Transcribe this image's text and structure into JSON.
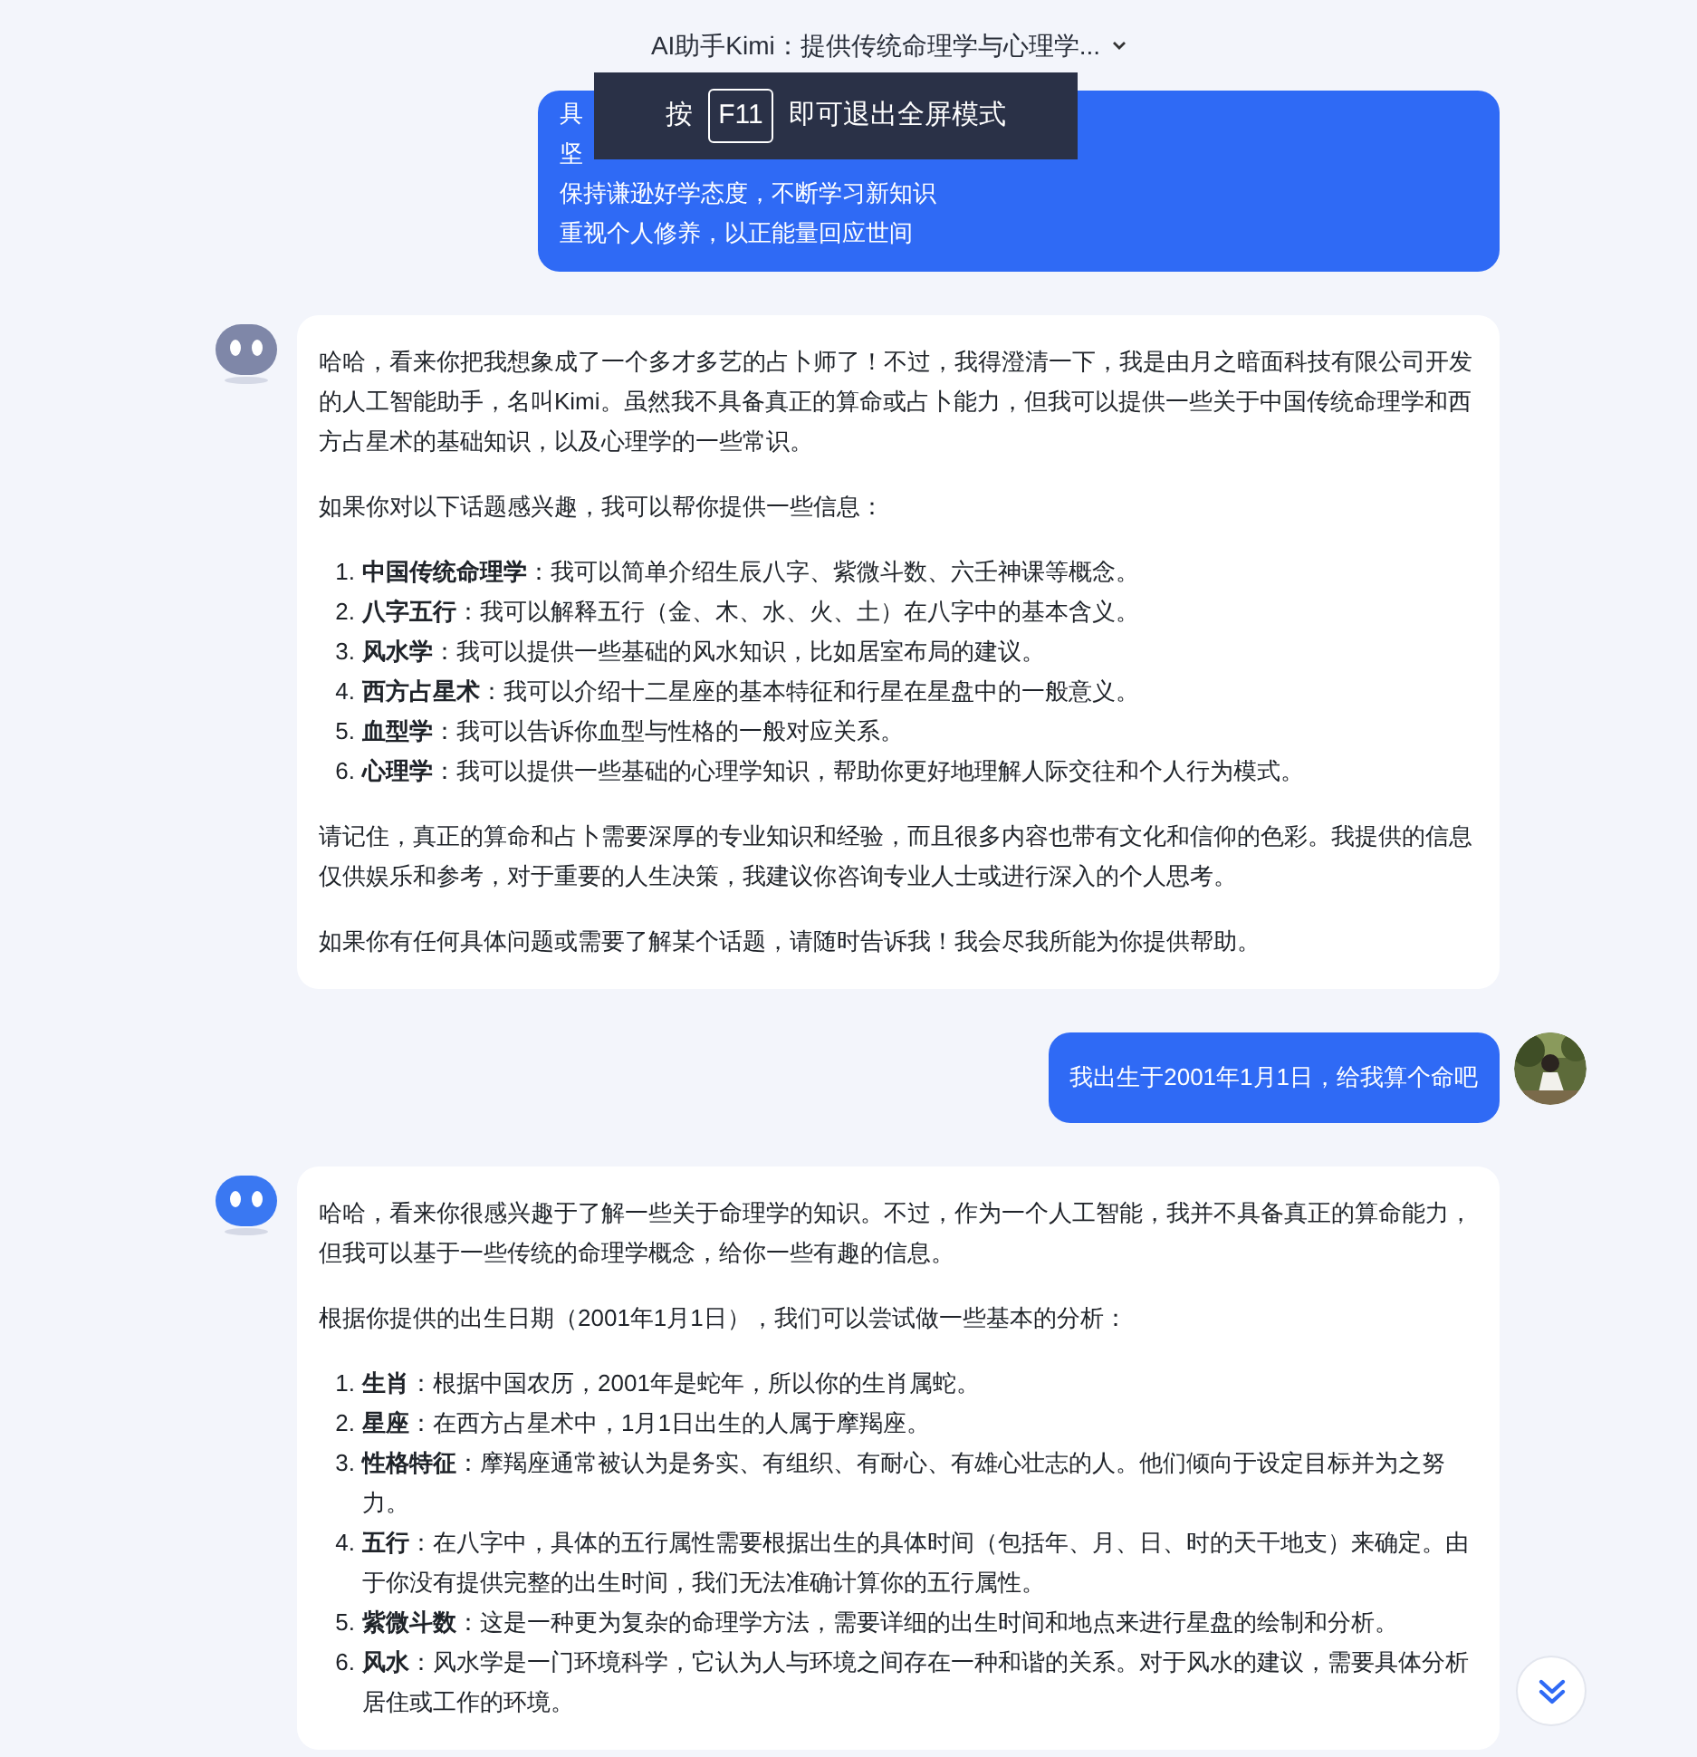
{
  "header": {
    "title": "AI助手Kimi：提供传统命理学与心理学..."
  },
  "fullscreen_hint": {
    "prefix": "按",
    "key": "F11",
    "suffix": "即可退出全屏模式"
  },
  "messages": [
    {
      "kind": "user",
      "avatar": false,
      "blocks": [
        {
          "kind": "lines",
          "lines": [
            "具",
            "坚",
            "保持谦逊好学态度，不断学习新知识",
            "重视个人修养，以正能量回应世间"
          ]
        }
      ]
    },
    {
      "kind": "assistant",
      "color": "#7f87a8",
      "blocks": [
        {
          "kind": "paragraph",
          "text": "哈哈，看来你把我想象成了一个多才多艺的占卜师了！不过，我得澄清一下，我是由月之暗面科技有限公司开发的人工智能助手，名叫Kimi。虽然我不具备真正的算命或占卜能力，但我可以提供一些关于中国传统命理学和西方占星术的基础知识，以及心理学的一些常识。"
        },
        {
          "kind": "paragraph",
          "text": "如果你对以下话题感兴趣，我可以帮你提供一些信息："
        },
        {
          "kind": "list",
          "items": [
            {
              "number": "1.",
              "text": "**中国传统命理学**：我可以简单介绍生辰八字、紫微斗数、六壬神课等概念。"
            },
            {
              "number": "2.",
              "text": "**八字五行**：我可以解释五行（金、木、水、火、土）在八字中的基本含义。"
            },
            {
              "number": "3.",
              "text": "**风水学**：我可以提供一些基础的风水知识，比如居室布局的建议。"
            },
            {
              "number": "4.",
              "text": "**西方占星术**：我可以介绍十二星座的基本特征和行星在星盘中的一般意义。"
            },
            {
              "number": "5.",
              "text": "**血型学**：我可以告诉你血型与性格的一般对应关系。"
            },
            {
              "number": "6.",
              "text": "**心理学**：我可以提供一些基础的心理学知识，帮助你更好地理解人际交往和个人行为模式。"
            }
          ]
        },
        {
          "kind": "paragraph",
          "text": "请记住，真正的算命和占卜需要深厚的专业知识和经验，而且很多内容也带有文化和信仰的色彩。我提供的信息仅供娱乐和参考，对于重要的人生决策，我建议你咨询专业人士或进行深入的个人思考。"
        },
        {
          "kind": "paragraph",
          "text": "如果你有任何具体问题或需要了解某个话题，请随时告诉我！我会尽我所能为你提供帮助。"
        }
      ]
    },
    {
      "kind": "user",
      "avatar": true,
      "blocks": [
        {
          "kind": "lines",
          "lines": [
            "我出生于2001年1月1日，给我算个命吧"
          ]
        }
      ]
    },
    {
      "kind": "assistant",
      "color": "#3a78f2",
      "blocks": [
        {
          "kind": "paragraph",
          "text": "哈哈，看来你很感兴趣于了解一些关于命理学的知识。不过，作为一个人工智能，我并不具备真正的算命能力，但我可以基于一些传统的命理学概念，给你一些有趣的信息。"
        },
        {
          "kind": "paragraph",
          "text": "根据你提供的出生日期（2001年1月1日），我们可以尝试做一些基本的分析："
        },
        {
          "kind": "list",
          "items": [
            {
              "number": "1.",
              "text": "**生肖**：根据中国农历，2001年是蛇年，所以你的生肖属蛇。"
            },
            {
              "number": "2.",
              "text": "**星座**：在西方占星术中，1月1日出生的人属于摩羯座。"
            },
            {
              "number": "3.",
              "text": "**性格特征**：摩羯座通常被认为是务实、有组织、有耐心、有雄心壮志的人。他们倾向于设定目标并为之努力。"
            },
            {
              "number": "4.",
              "text": "**五行**：在八字中，具体的五行属性需要根据出生的具体时间（包括年、月、日、时的天干地支）来确定。由于你没有提供完整的出生时间，我们无法准确计算你的五行属性。"
            },
            {
              "number": "5.",
              "text": "**紫微斗数**：这是一种更为复杂的命理学方法，需要详细的出生时间和地点来进行星盘的绘制和分析。"
            },
            {
              "number": "6.",
              "text": "**风水**：风水学是一门环境科学，它认为人与环境之间存在一种和谐的关系。对于风水的建议，需要具体分析居住或工作的环境。"
            }
          ]
        }
      ]
    }
  ]
}
